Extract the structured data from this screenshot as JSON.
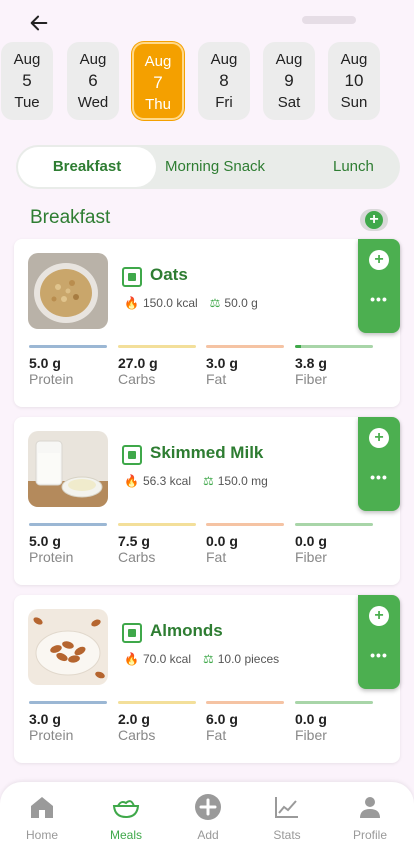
{
  "colors": {
    "accent": "#3fa84a",
    "selected_date": "#f4a000",
    "protein": "#9bb7d4",
    "carbs": "#f3df9a",
    "fat": "#f5c3a3",
    "fiber": "#a8d5a8"
  },
  "header": {
    "back_icon": "arrow-left-icon"
  },
  "dates": [
    {
      "month": "Aug",
      "day": "5",
      "weekday": "Tue"
    },
    {
      "month": "Aug",
      "day": "6",
      "weekday": "Wed"
    },
    {
      "month": "Aug",
      "day": "7",
      "weekday": "Thu",
      "selected": true
    },
    {
      "month": "Aug",
      "day": "8",
      "weekday": "Fri"
    },
    {
      "month": "Aug",
      "day": "9",
      "weekday": "Sat"
    },
    {
      "month": "Aug",
      "day": "10",
      "weekday": "Sun"
    }
  ],
  "meal_tabs": [
    "Breakfast",
    "Morning Snack",
    "Lunch"
  ],
  "section": {
    "title": "Breakfast"
  },
  "foods": [
    {
      "name": "Oats",
      "calories": "150.0 kcal",
      "amount": "50.0 g",
      "nutrients": [
        {
          "value": "5.0 g",
          "label": "Protein"
        },
        {
          "value": "27.0 g",
          "label": "Carbs"
        },
        {
          "value": "3.0 g",
          "label": "Fat"
        },
        {
          "value": "3.8 g",
          "label": "Fiber"
        }
      ]
    },
    {
      "name": "Skimmed Milk",
      "calories": "56.3 kcal",
      "amount": "150.0 mg",
      "nutrients": [
        {
          "value": "5.0 g",
          "label": "Protein"
        },
        {
          "value": "7.5 g",
          "label": "Carbs"
        },
        {
          "value": "0.0 g",
          "label": "Fat"
        },
        {
          "value": "0.0 g",
          "label": "Fiber"
        }
      ]
    },
    {
      "name": "Almonds",
      "calories": "70.0 kcal",
      "amount": "10.0 pieces",
      "nutrients": [
        {
          "value": "3.0 g",
          "label": "Protein"
        },
        {
          "value": "2.0 g",
          "label": "Carbs"
        },
        {
          "value": "6.0 g",
          "label": "Fat"
        },
        {
          "value": "0.0 g",
          "label": "Fiber"
        }
      ]
    }
  ],
  "card_actions": {
    "add": "+",
    "more": "•••"
  },
  "bottom_nav": [
    {
      "label": "Home",
      "icon": "home-icon"
    },
    {
      "label": "Meals",
      "icon": "bowl-icon",
      "selected": true
    },
    {
      "label": "Add",
      "icon": "plus-circle-icon"
    },
    {
      "label": "Stats",
      "icon": "chart-icon"
    },
    {
      "label": "Profile",
      "icon": "person-icon"
    }
  ]
}
